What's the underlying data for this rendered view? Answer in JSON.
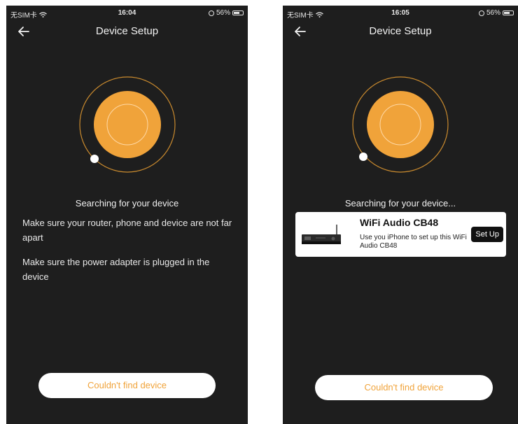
{
  "screens": [
    {
      "status": {
        "carrier": "无SIM卡",
        "time": "16:04",
        "battery": "56%"
      },
      "nav": {
        "title": "Device Setup"
      },
      "searching_text": "Searching for your device",
      "tips": [
        "Make sure your router, phone and device are not far apart",
        "Make sure the power adapter is plugged in the device"
      ],
      "bottom_button": "Couldn't find device"
    },
    {
      "status": {
        "carrier": "无SIM卡",
        "time": "16:05",
        "battery": "56%"
      },
      "nav": {
        "title": "Device Setup"
      },
      "searching_text": "Searching for your device...",
      "device": {
        "name": "WiFi Audio CB48",
        "description": "Use you iPhone to set up this WiFi Audio CB48",
        "action": "Set Up"
      },
      "bottom_button": "Couldn't find device"
    }
  ],
  "colors": {
    "accent": "#f0a33a",
    "background": "#1e1e1e",
    "ring": "#c98a2e"
  },
  "icons": {
    "back": "arrow-left-icon",
    "wifi": "wifi-icon",
    "alarm": "alarm-icon",
    "battery": "battery-icon"
  }
}
